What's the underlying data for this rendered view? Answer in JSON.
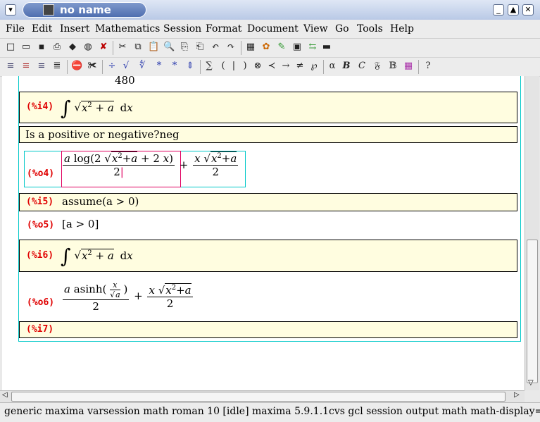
{
  "window": {
    "title": "no name"
  },
  "menu": [
    "File",
    "Edit",
    "Insert",
    "Mathematics",
    "Session",
    "Format",
    "Document",
    "View",
    "Go",
    "Tools",
    "Help"
  ],
  "toolbar1_icons": [
    "new-icon",
    "open-icon",
    "save-icon",
    "print-icon",
    "book-icon",
    "globe-icon",
    "close-icon",
    "cut-icon",
    "copy-icon",
    "paste-icon",
    "find-icon",
    "find-replace-icon",
    "find-next-icon",
    "undo-icon",
    "redo-icon",
    "table-icon",
    "palette-icon",
    "pen-icon",
    "frame-icon",
    "link-icon",
    "monitor-icon"
  ],
  "toolbar2_symbols": [
    "∑",
    "(",
    "|",
    ")",
    "⊗",
    "≺",
    "→",
    "≠",
    "℘",
    "α",
    "B",
    "C",
    "𝔉",
    "𝔹"
  ],
  "doc": {
    "prev_output": "480",
    "i4": {
      "label": "(%i4)"
    },
    "question": "Is a positive or negative?neg",
    "o4": {
      "label": "(%o4)"
    },
    "i5": {
      "label": "(%i5)",
      "text": "assume(a > 0)"
    },
    "o5": {
      "label": "(%o5)",
      "text": "[a > 0]"
    },
    "i6": {
      "label": "(%i6)"
    },
    "o6": {
      "label": "(%o6)"
    },
    "i7": {
      "label": "(%i7)"
    }
  },
  "status": "generic maxima varsession math roman 10 [idle]  maxima 5.9.1.1cvs gcl session output math math-display=true de"
}
